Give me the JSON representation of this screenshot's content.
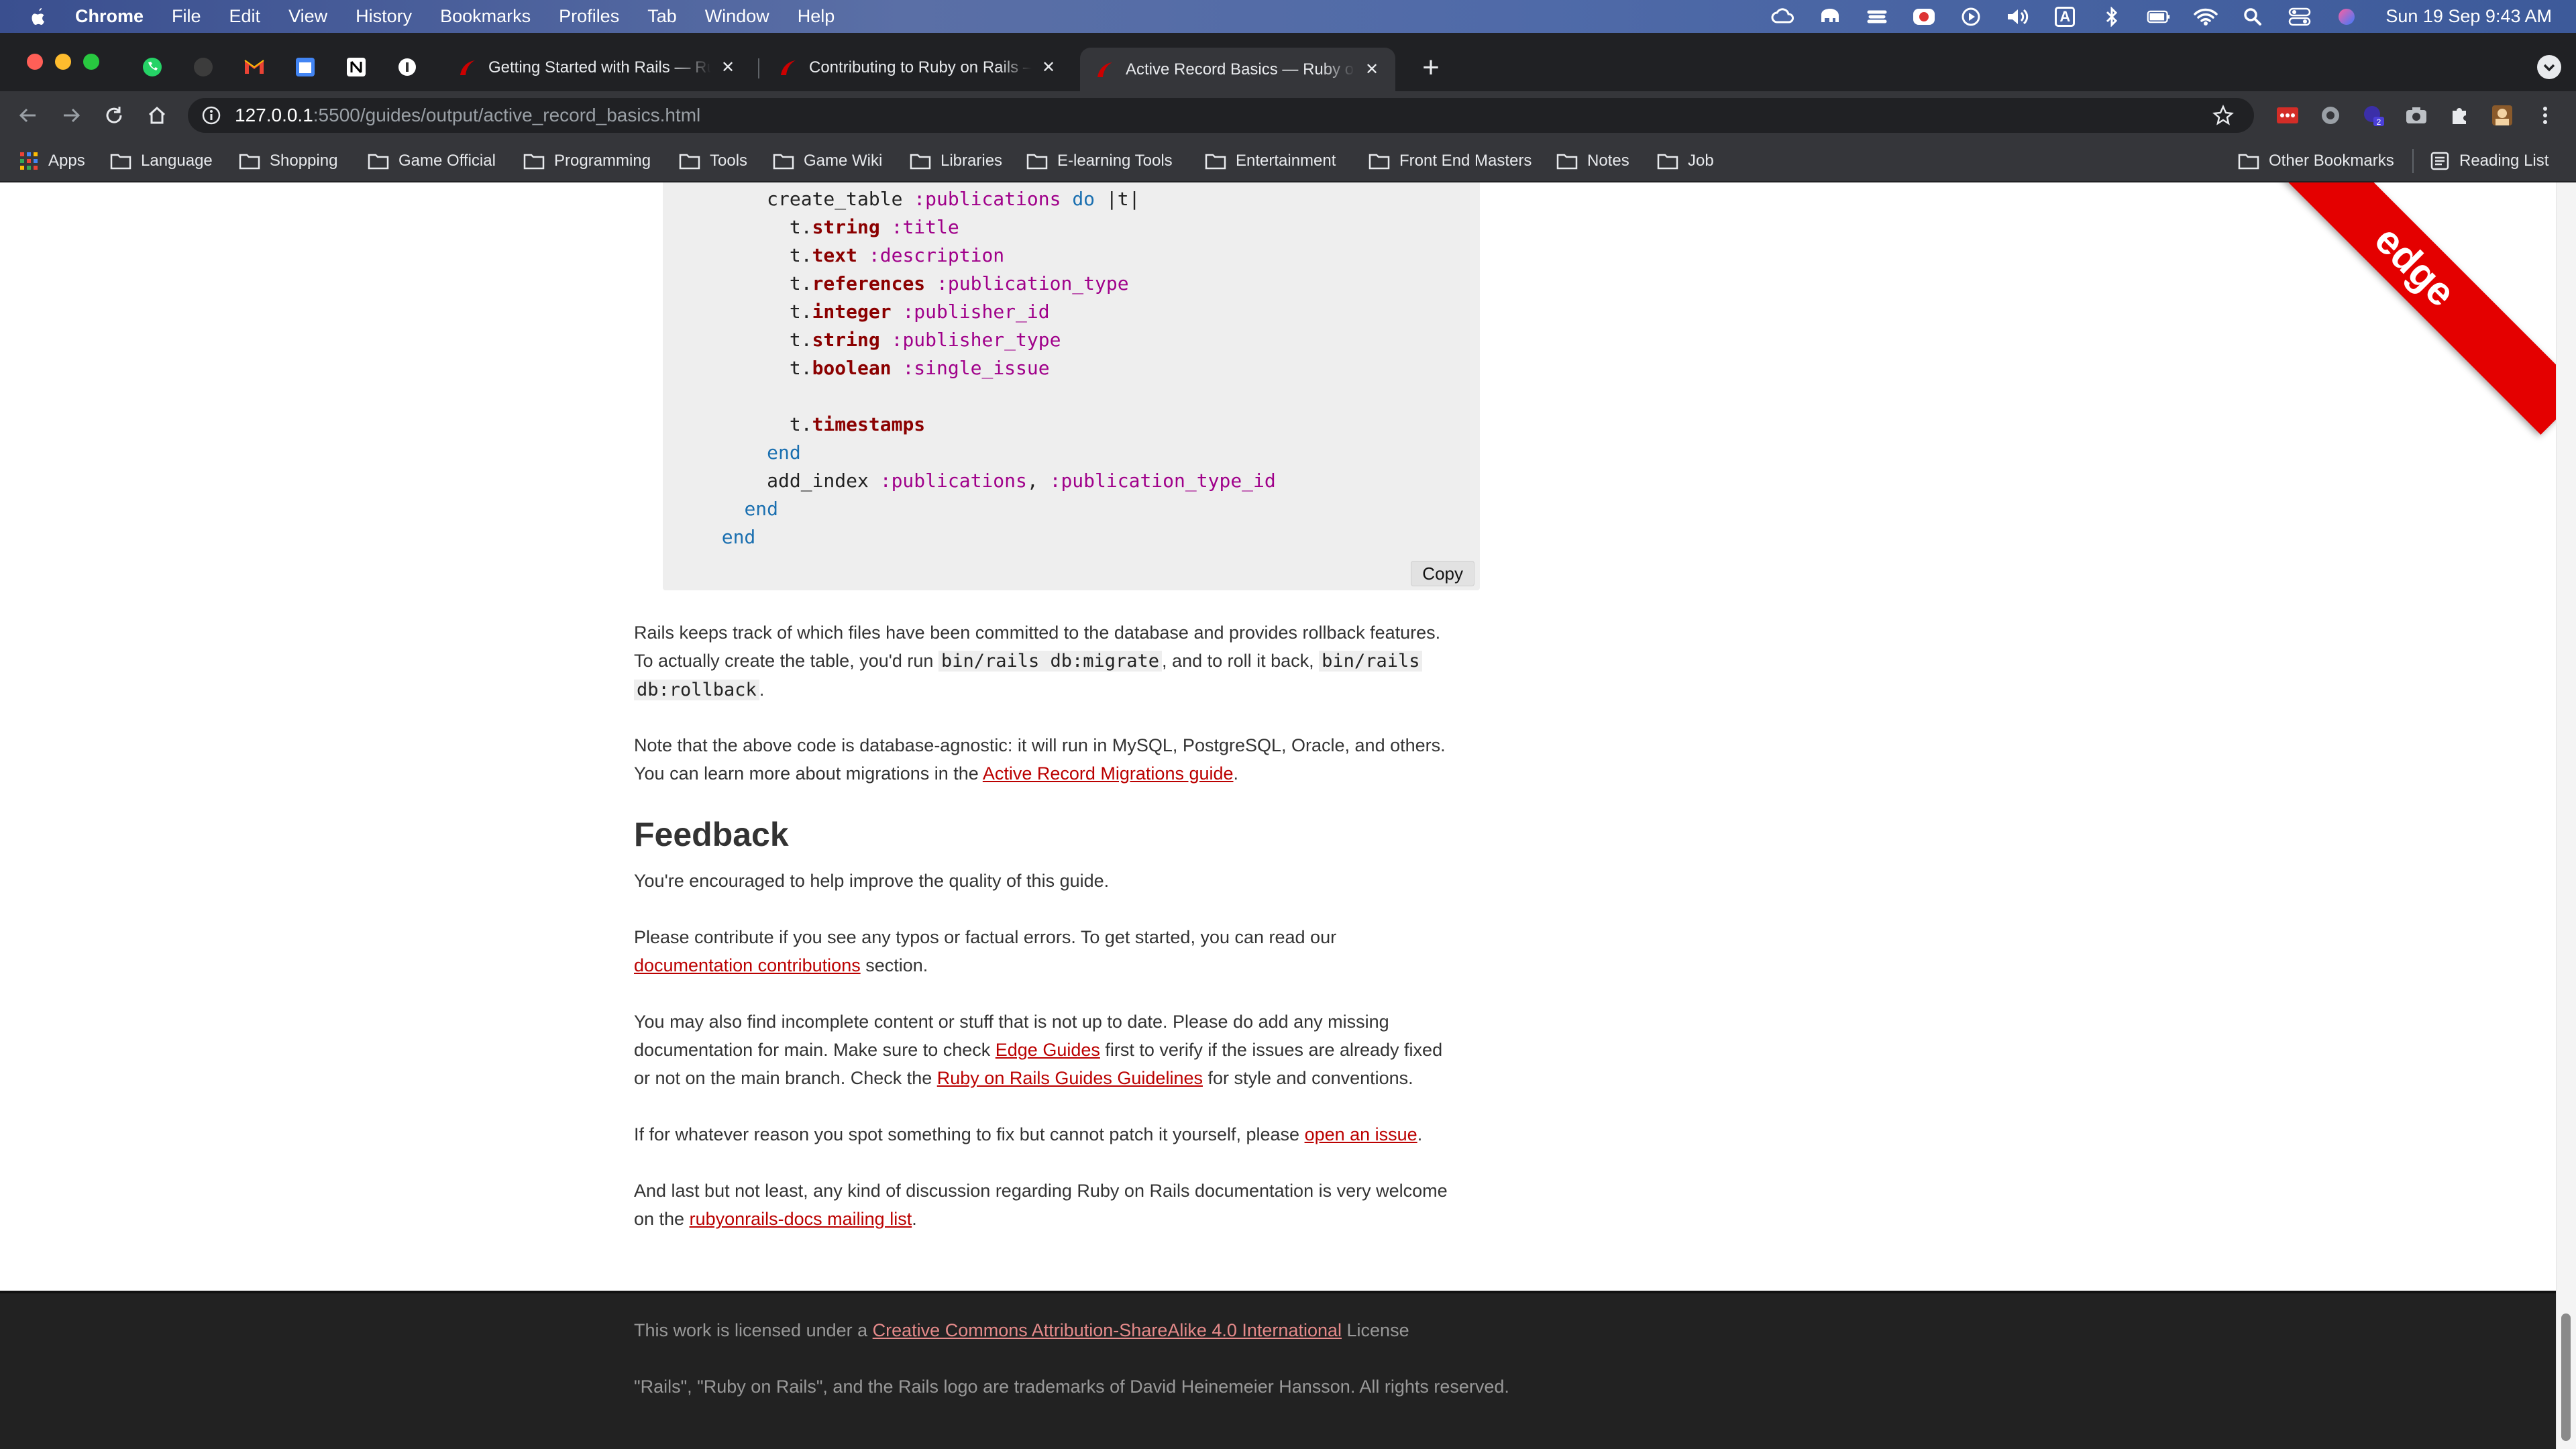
{
  "menubar": {
    "app": "Chrome",
    "menus": [
      "File",
      "Edit",
      "View",
      "History",
      "Bookmarks",
      "Profiles",
      "Tab",
      "Window",
      "Help"
    ],
    "clock": "Sun 19 Sep  9:43 AM",
    "input_source": "A"
  },
  "tabs": [
    {
      "title": "Getting Started with Rails — Ruby on Rails Guides",
      "active": false
    },
    {
      "title": "Contributing to Ruby on Rails — Ruby on Rails Guides",
      "active": false
    },
    {
      "title": "Active Record Basics — Ruby on Rails Guides",
      "active": true
    }
  ],
  "toolbar": {
    "url_host": "127.0.0.1",
    "url_rest": ":5500/guides/output/active_record_basics.html"
  },
  "bookmarks": {
    "apps": "Apps",
    "folders": [
      "Language",
      "Shopping",
      "Game Official",
      "Programming",
      "Tools",
      "Game Wiki",
      "Libraries",
      "E-learning Tools",
      "Entertainment",
      "Front End Masters",
      "Notes",
      "Job"
    ],
    "other": "Other Bookmarks",
    "reading_list": "Reading List"
  },
  "ribbon": "edge",
  "code": {
    "copy_label": "Copy"
  },
  "content": {
    "p1_a": "Rails keeps track of which files have been committed to the database and provides rollback features.",
    "p1_b": "To actually create the table, you'd run ",
    "p1_code1": "bin/rails db:migrate",
    "p1_c": ", and to roll it back, ",
    "p1_code2a": "bin/rails",
    "p1_code2b": "db:rollback",
    "p1_d": ".",
    "p2_a": "Note that the above code is database-agnostic: it will run in MySQL, PostgreSQL, Oracle, and others.",
    "p2_b": "You can learn more about migrations in the ",
    "p2_link": "Active Record Migrations guide",
    "p2_c": ".",
    "feedback_heading": "Feedback",
    "p3": "You're encouraged to help improve the quality of this guide.",
    "p4_a": "Please contribute if you see any typos or factual errors. To get started, you can read our",
    "p4_link": "documentation contributions",
    "p4_b": " section.",
    "p5_a": "You may also find incomplete content or stuff that is not up to date. Please do add any missing",
    "p5_b": "documentation for main. Make sure to check ",
    "p5_link1": "Edge Guides",
    "p5_c": " first to verify if the issues are already fixed",
    "p5_d": "or not on the main branch. Check the ",
    "p5_link2": "Ruby on Rails Guides Guidelines",
    "p5_e": " for style and conventions.",
    "p6_a": "If for whatever reason you spot something to fix but cannot patch it yourself, please ",
    "p6_link": "open an issue",
    "p6_b": ".",
    "p7_a": "And last but not least, any kind of discussion regarding Ruby on Rails documentation is very welcome",
    "p7_b": "on the ",
    "p7_link": "rubyonrails-docs mailing list",
    "p7_c": "."
  },
  "footer": {
    "license_a": "This work is licensed under a ",
    "license_link": "Creative Commons Attribution-ShareAlike 4.0 International",
    "license_b": " License",
    "trademark": "\"Rails\", \"Ruby on Rails\", and the Rails logo are trademarks of David Heinemeier Hansson. All rights reserved."
  }
}
